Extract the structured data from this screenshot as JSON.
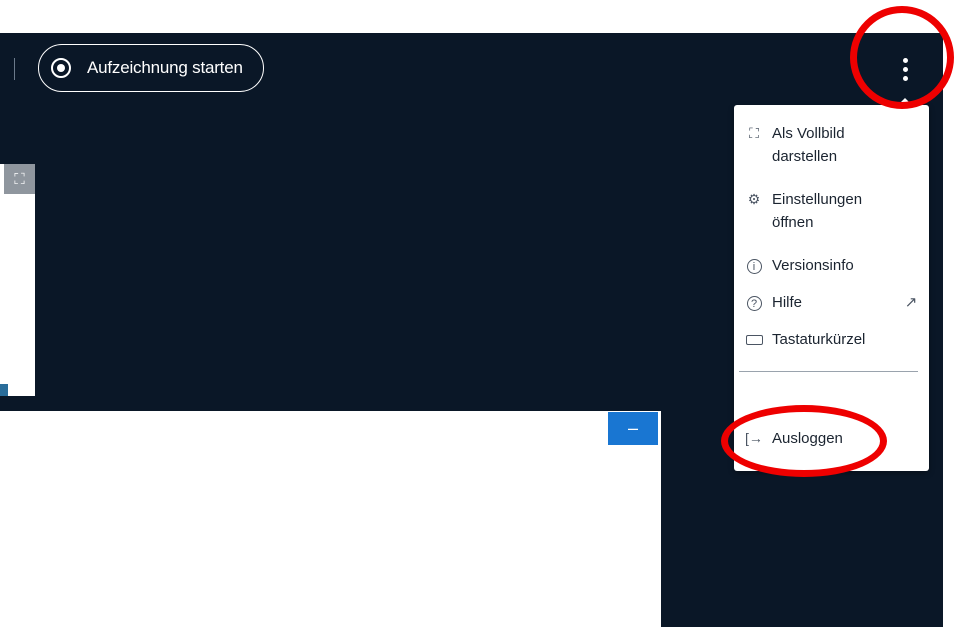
{
  "toolbar": {
    "record_label": "Aufzeichnung starten",
    "record_icon": "record-icon",
    "more_icon": "kebab-menu-icon"
  },
  "menu": {
    "items": [
      {
        "label_line1": "Als Vollbild",
        "label_line2": "darstellen",
        "icon": "fullscreen-icon"
      },
      {
        "label_line1": "Einstellungen",
        "label_line2": "öffnen",
        "icon": "gear-icon"
      },
      {
        "label": "Versionsinfo",
        "icon": "info-icon"
      },
      {
        "label": "Hilfe",
        "icon": "help-icon",
        "external_icon": "external-link-icon"
      },
      {
        "label": "Tastaturkürzel",
        "icon": "keyboard-icon"
      },
      {
        "label": "Ausloggen",
        "icon": "logout-icon"
      }
    ]
  },
  "minimize": {
    "label": "–",
    "icon": "minimize-icon"
  },
  "colors": {
    "background_dark": "#0a1727",
    "highlight": "#ee0000",
    "accent": "#1976d2"
  }
}
